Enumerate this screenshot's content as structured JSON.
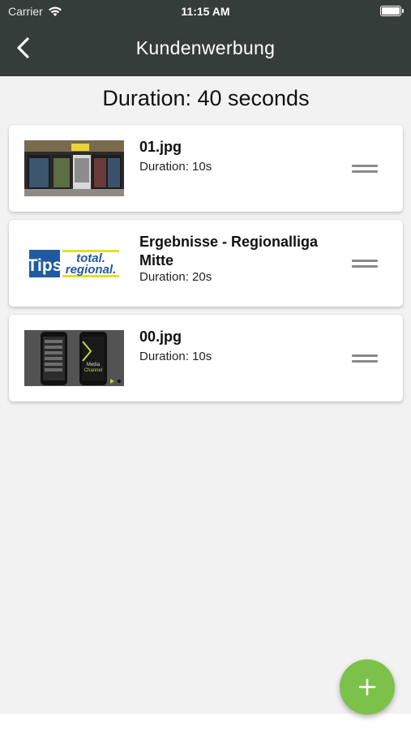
{
  "status_bar": {
    "carrier": "Carrier",
    "time": "11:15 AM"
  },
  "nav": {
    "title": "Kundenwerbung"
  },
  "summary": {
    "total_duration": "Duration: 40 seconds"
  },
  "items": [
    {
      "name": "01.jpg",
      "duration": "Duration: 10s",
      "thumbnail": "vending-machines-photo"
    },
    {
      "name": "Ergebnisse - Regionalliga Mitte",
      "duration": "Duration: 20s",
      "thumbnail": "tips-logo",
      "thumb_text": {
        "left": "Tips",
        "top": "total.",
        "bottom": "regional."
      }
    },
    {
      "name": "00.jpg",
      "duration": "Duration: 10s",
      "thumbnail": "phones-mockup",
      "thumb_text": {
        "line1": "Media",
        "line2": "Channel"
      }
    }
  ],
  "fab": {
    "icon": "plus-icon"
  },
  "colors": {
    "nav_bg": "#353d3a",
    "accent": "#7cc24a",
    "tips_blue": "#1f5aa0",
    "tips_yellow": "#e0e02a"
  }
}
